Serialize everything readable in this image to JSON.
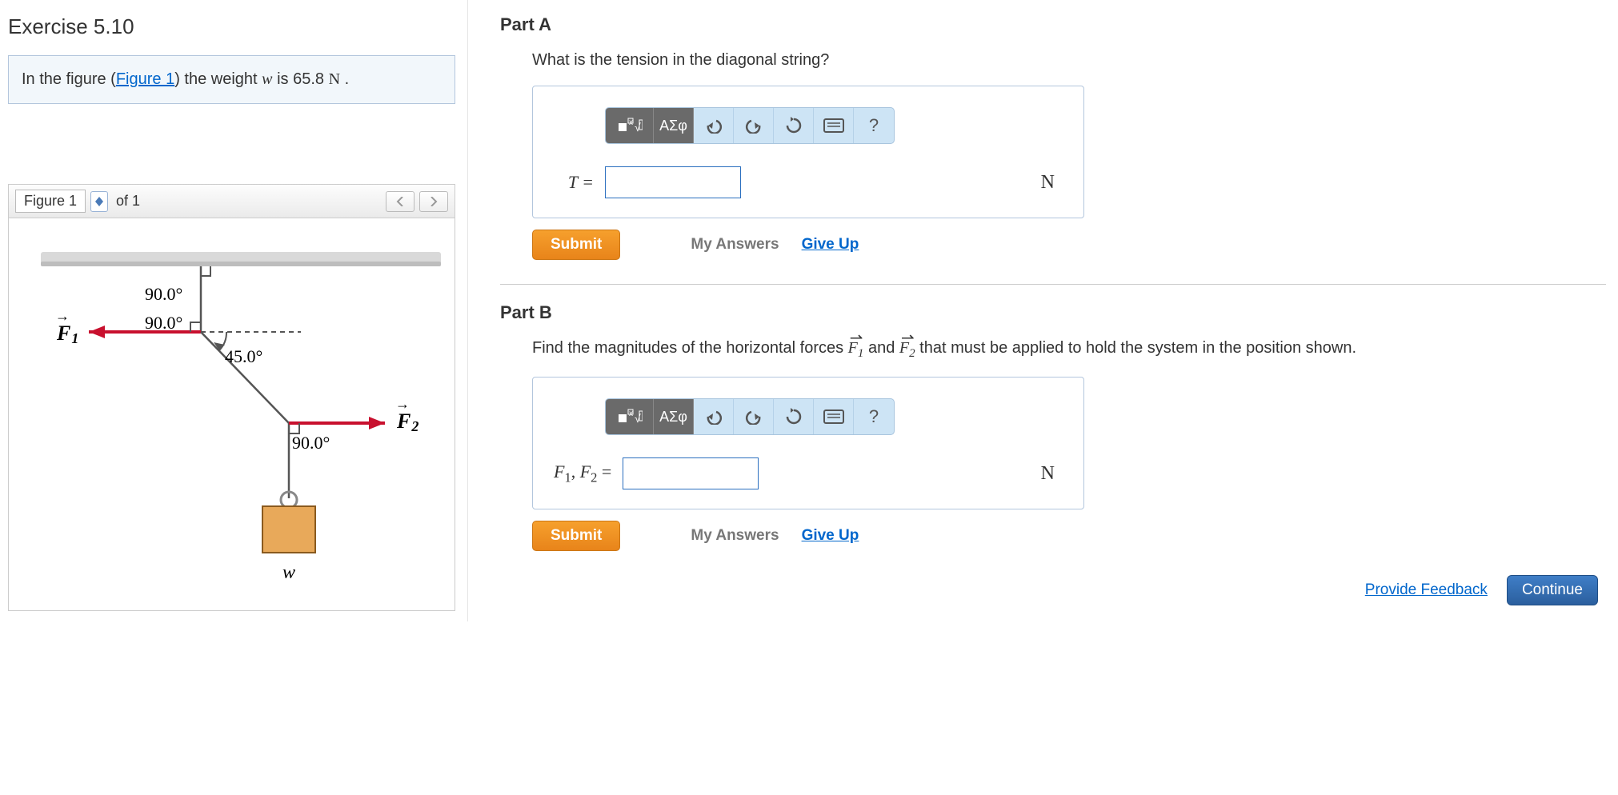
{
  "exercise": {
    "title": "Exercise 5.10"
  },
  "problem": {
    "prefix": "In the figure (",
    "figure_link": "Figure 1",
    "suffix_before_var": ") the weight ",
    "variable": "w",
    "suffix_after_var": " is 65.8 ",
    "unit": "N",
    "period": " ."
  },
  "figure_panel": {
    "name": "Figure 1",
    "of_text": "of 1"
  },
  "figure": {
    "angle_top": "90.0°",
    "angle_f1": "90.0°",
    "angle_diag": "45.0°",
    "angle_bottom": "90.0°",
    "f1_label": "F",
    "f1_sub": "1",
    "f2_label": "F",
    "f2_sub": "2",
    "w_label": "w"
  },
  "partA": {
    "title": "Part A",
    "question": "What is the tension in the diagonal string?",
    "var_label": "T =",
    "unit": "N",
    "submit": "Submit",
    "my_answers": "My Answers",
    "give_up": "Give Up"
  },
  "partB": {
    "title": "Part B",
    "q_prefix": "Find the magnitudes of the horizontal forces ",
    "q_mid": " and ",
    "q_suffix": " that must be applied to hold the system in the position shown.",
    "var_label": "F₁, F₂ =",
    "unit": "N",
    "submit": "Submit",
    "my_answers": "My Answers",
    "give_up": "Give Up"
  },
  "vectors": {
    "f1": "F",
    "f1_sub": "1",
    "f2": "F",
    "f2_sub": "2"
  },
  "toolbar": {
    "greek": "ΑΣφ"
  },
  "footer": {
    "feedback": "Provide Feedback",
    "continue": "Continue"
  }
}
